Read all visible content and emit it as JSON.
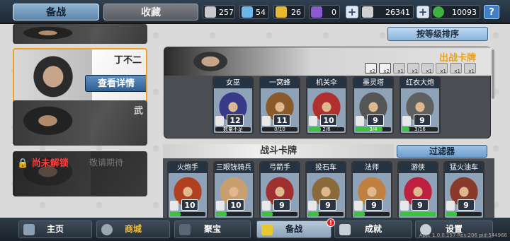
{
  "tabs": [
    {
      "label": "备战",
      "active": true
    },
    {
      "label": "收藏",
      "active": false
    }
  ],
  "resources": [
    {
      "icon": "silver-gem-icon",
      "value": "257",
      "color": "#c8c8c8"
    },
    {
      "icon": "blue-crystal-icon",
      "value": "54",
      "color": "#6fb6e8"
    },
    {
      "icon": "gold-token-icon",
      "value": "26",
      "color": "#e8b830"
    },
    {
      "icon": "purple-token-icon",
      "value": "0",
      "color": "#8a5ad0"
    },
    {
      "icon": "coin-icon",
      "value": "26341",
      "color": "#d0d0d0"
    },
    {
      "icon": "green-gem-icon",
      "value": "10093",
      "color": "#40b040"
    }
  ],
  "help_label": "?",
  "heroes": [
    {
      "name": "丁不二",
      "detail_button": "查看详情",
      "selected": true
    },
    {
      "name": "武",
      "selected": false
    },
    {
      "name": "尚未解锁",
      "sub": "敬请期待",
      "locked": true
    }
  ],
  "sort_button": "按等级排序",
  "deck": {
    "title": "出战卡牌",
    "slot_labels": [
      "x2",
      "x2",
      "x1",
      "x1",
      "x1",
      "x1",
      "x1",
      "x1"
    ],
    "cards": [
      {
        "name": "女巫",
        "level": "12",
        "count": "数量不足",
        "progress": 0.0,
        "art": "#3a3a8a"
      },
      {
        "name": "一窝蜂",
        "level": "11",
        "count": "0/10",
        "progress": 0.0,
        "art": "#8a5a2a"
      },
      {
        "name": "机关伞",
        "level": "10",
        "count": "2/6",
        "progress": 0.33,
        "art": "#b03030"
      },
      {
        "name": "墨灵塔",
        "level": "9",
        "count": "3/4",
        "progress": 0.75,
        "art": "#555555"
      },
      {
        "name": "红衣大炮",
        "level": "9",
        "count": "3/16",
        "progress": 0.19,
        "art": "#606060"
      }
    ]
  },
  "battle": {
    "title": "战斗卡牌",
    "filter_button": "过滤器",
    "cards": [
      {
        "name": "火炮手",
        "level": "10",
        "count": "",
        "progress": 0.3,
        "art": "#b04020"
      },
      {
        "name": "三眼铳骑兵",
        "level": "10",
        "count": "",
        "progress": 0.3,
        "art": "#c8a070"
      },
      {
        "name": "弓箭手",
        "level": "9",
        "count": "",
        "progress": 0.3,
        "art": "#a03030"
      },
      {
        "name": "投石车",
        "level": "9",
        "count": "",
        "progress": 0.3,
        "art": "#8a6a3a"
      },
      {
        "name": "法师",
        "level": "9",
        "count": "",
        "progress": 0.3,
        "art": "#c08040"
      },
      {
        "name": "游侠",
        "level": "9",
        "count": "",
        "progress": 1.0,
        "art": "#c02040"
      },
      {
        "name": "猛火油车",
        "level": "9",
        "count": "",
        "progress": 0.3,
        "art": "#8a3a2a"
      }
    ]
  },
  "nav": [
    {
      "label": "主页",
      "icon": "home-icon",
      "active": false
    },
    {
      "label": "商城",
      "icon": "shop-icon",
      "active": false,
      "highlight": "#f0c040"
    },
    {
      "label": "聚宝",
      "icon": "treasure-icon",
      "active": false
    },
    {
      "label": "备战",
      "icon": "battle-prep-icon",
      "active": true
    },
    {
      "label": "成就",
      "icon": "achievement-icon",
      "active": false
    },
    {
      "label": "设置",
      "icon": "gear-icon",
      "active": false
    }
  ],
  "nav_badge": "!",
  "version": "App: 1.0.0.157 Res:206 pid:544966"
}
